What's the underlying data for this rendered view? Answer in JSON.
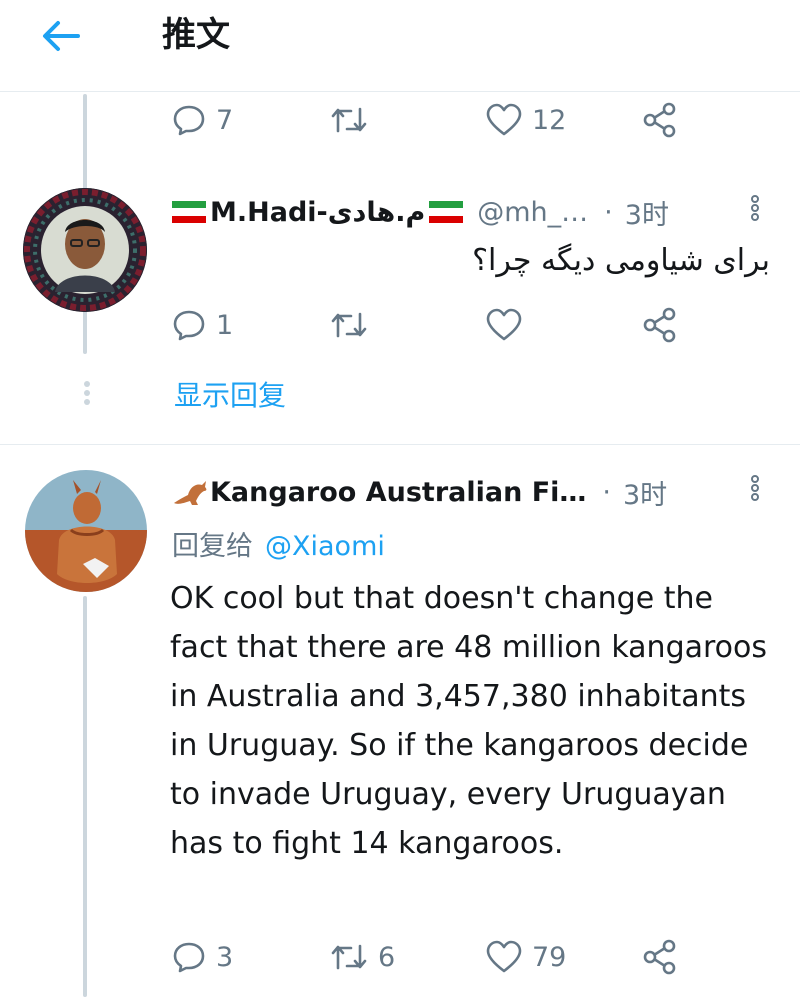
{
  "header": {
    "title": "推文",
    "back_icon": "arrow-left-icon",
    "accent": "#1da1f2"
  },
  "colors": {
    "accent": "#1da1f2",
    "secondary_text": "#657786",
    "divider": "#e6ecf0"
  },
  "top_actions": {
    "reply_count": "7",
    "retweet_count": "",
    "like_count": "12"
  },
  "tweet1": {
    "name": "M.Hadi-م.هادی",
    "handle": "@mh_…",
    "dot": "·",
    "time": "3时",
    "text": "برای شیاومی دیگه چرا؟",
    "reply_count": "1",
    "retweet_count": "",
    "like_count": ""
  },
  "show_replies": "显示回复",
  "tweet2": {
    "name": "Kangaroo Australian Fi…",
    "dot": "·",
    "time": "3时",
    "reply_prefix": "回复给",
    "reply_mention": "@Xiaomi",
    "text": "OK cool but that doesn't change the fact that there are 48 million kangaroos in Australia and 3,457,380 inhabitants in Uruguay. So if the kangaroos decide to invade Uruguay, every Uruguayan has to fight 14 kangaroos.",
    "reply_count": "3",
    "retweet_count": "6",
    "like_count": "79"
  }
}
